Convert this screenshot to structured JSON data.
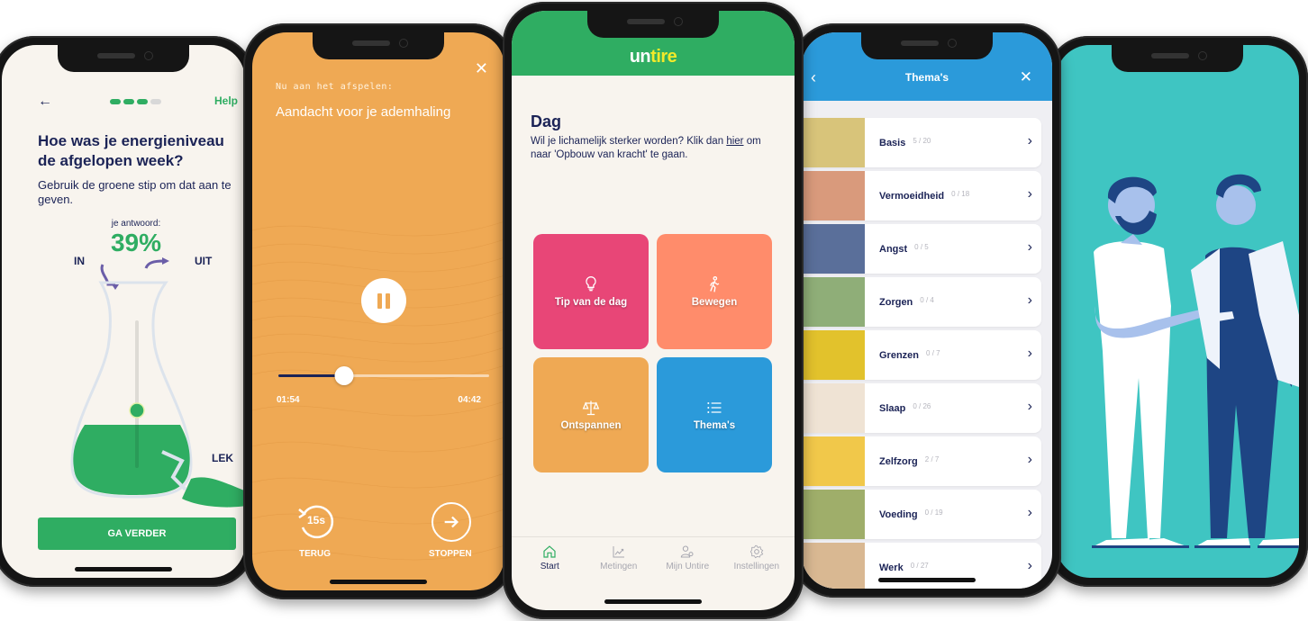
{
  "phone1": {
    "help_label": "Help",
    "progress_steps": 4,
    "progress_completed": 3,
    "question": "Hoe was je energieniveau de afgelopen week?",
    "instruction": "Gebruik de groene stip om dat aan te geven.",
    "answer_label": "je antwoord:",
    "answer_value": "39%",
    "slider_level_percent": 39,
    "label_in": "IN",
    "label_out": "UIT",
    "label_leak": "LEK",
    "cta_label": "GA VERDER",
    "colors": {
      "accent": "#2fad62",
      "text": "#1b2356",
      "background": "#f8f4ee"
    }
  },
  "phone2": {
    "now_playing_label": "Nu aan het afspelen:",
    "track_title": "Aandacht voor je ademhaling",
    "elapsed": "01:54",
    "duration": "04:42",
    "progress_fraction": 0.31,
    "rewind_label": "15s",
    "back_label": "TERUG",
    "stop_label": "STOPPEN",
    "colors": {
      "background": "#efa954",
      "progress": "#1b2356"
    }
  },
  "phone3": {
    "logo_part1": "un",
    "logo_part2": "tire",
    "heading": "Dag",
    "message_part1": "Wil je lichamelijk sterker worden? Klik dan ",
    "message_link": "hier",
    "message_part2": " om naar 'Opbouw van kracht' te gaan.",
    "tiles": [
      {
        "label": "Tip van de dag",
        "icon": "lightbulb-icon",
        "color": "#e84677"
      },
      {
        "label": "Bewegen",
        "icon": "walking-icon",
        "color": "#ff8c6b"
      },
      {
        "label": "Ontspannen",
        "icon": "scale-icon",
        "color": "#efa954"
      },
      {
        "label": "Thema's",
        "icon": "list-icon",
        "color": "#2b9ada"
      }
    ],
    "nav": [
      {
        "label": "Start",
        "icon": "home-icon",
        "active": true
      },
      {
        "label": "Metingen",
        "icon": "chart-icon",
        "active": false
      },
      {
        "label": "Mijn Untire",
        "icon": "user-settings-icon",
        "active": false
      },
      {
        "label": "Instellingen",
        "icon": "gear-icon",
        "active": false
      }
    ],
    "colors": {
      "header": "#2fad62",
      "logo_accent": "#f2ea2a"
    }
  },
  "phone4": {
    "title": "Thema's",
    "themes": [
      {
        "name": "Basis",
        "count": "5 / 20",
        "thumb": "#d8c47a"
      },
      {
        "name": "Vermoeidheid",
        "count": "0 / 18",
        "thumb": "#d99a7c"
      },
      {
        "name": "Angst",
        "count": "0 / 5",
        "thumb": "#5a6f9a"
      },
      {
        "name": "Zorgen",
        "count": "0 / 4",
        "thumb": "#8fae78"
      },
      {
        "name": "Grenzen",
        "count": "0 / 7",
        "thumb": "#e2c22c"
      },
      {
        "name": "Slaap",
        "count": "0 / 26",
        "thumb": "#efe3d4"
      },
      {
        "name": "Zelfzorg",
        "count": "2 / 7",
        "thumb": "#f1c84a"
      },
      {
        "name": "Voeding",
        "count": "0 / 19",
        "thumb": "#9fae6a"
      },
      {
        "name": "Werk",
        "count": "0 / 27",
        "thumb": "#d9b892"
      }
    ],
    "colors": {
      "header": "#2b9ada"
    }
  },
  "phone5": {
    "illustration": "two-people-handshake-illustration",
    "colors": {
      "background": "#3fc5c2"
    }
  }
}
